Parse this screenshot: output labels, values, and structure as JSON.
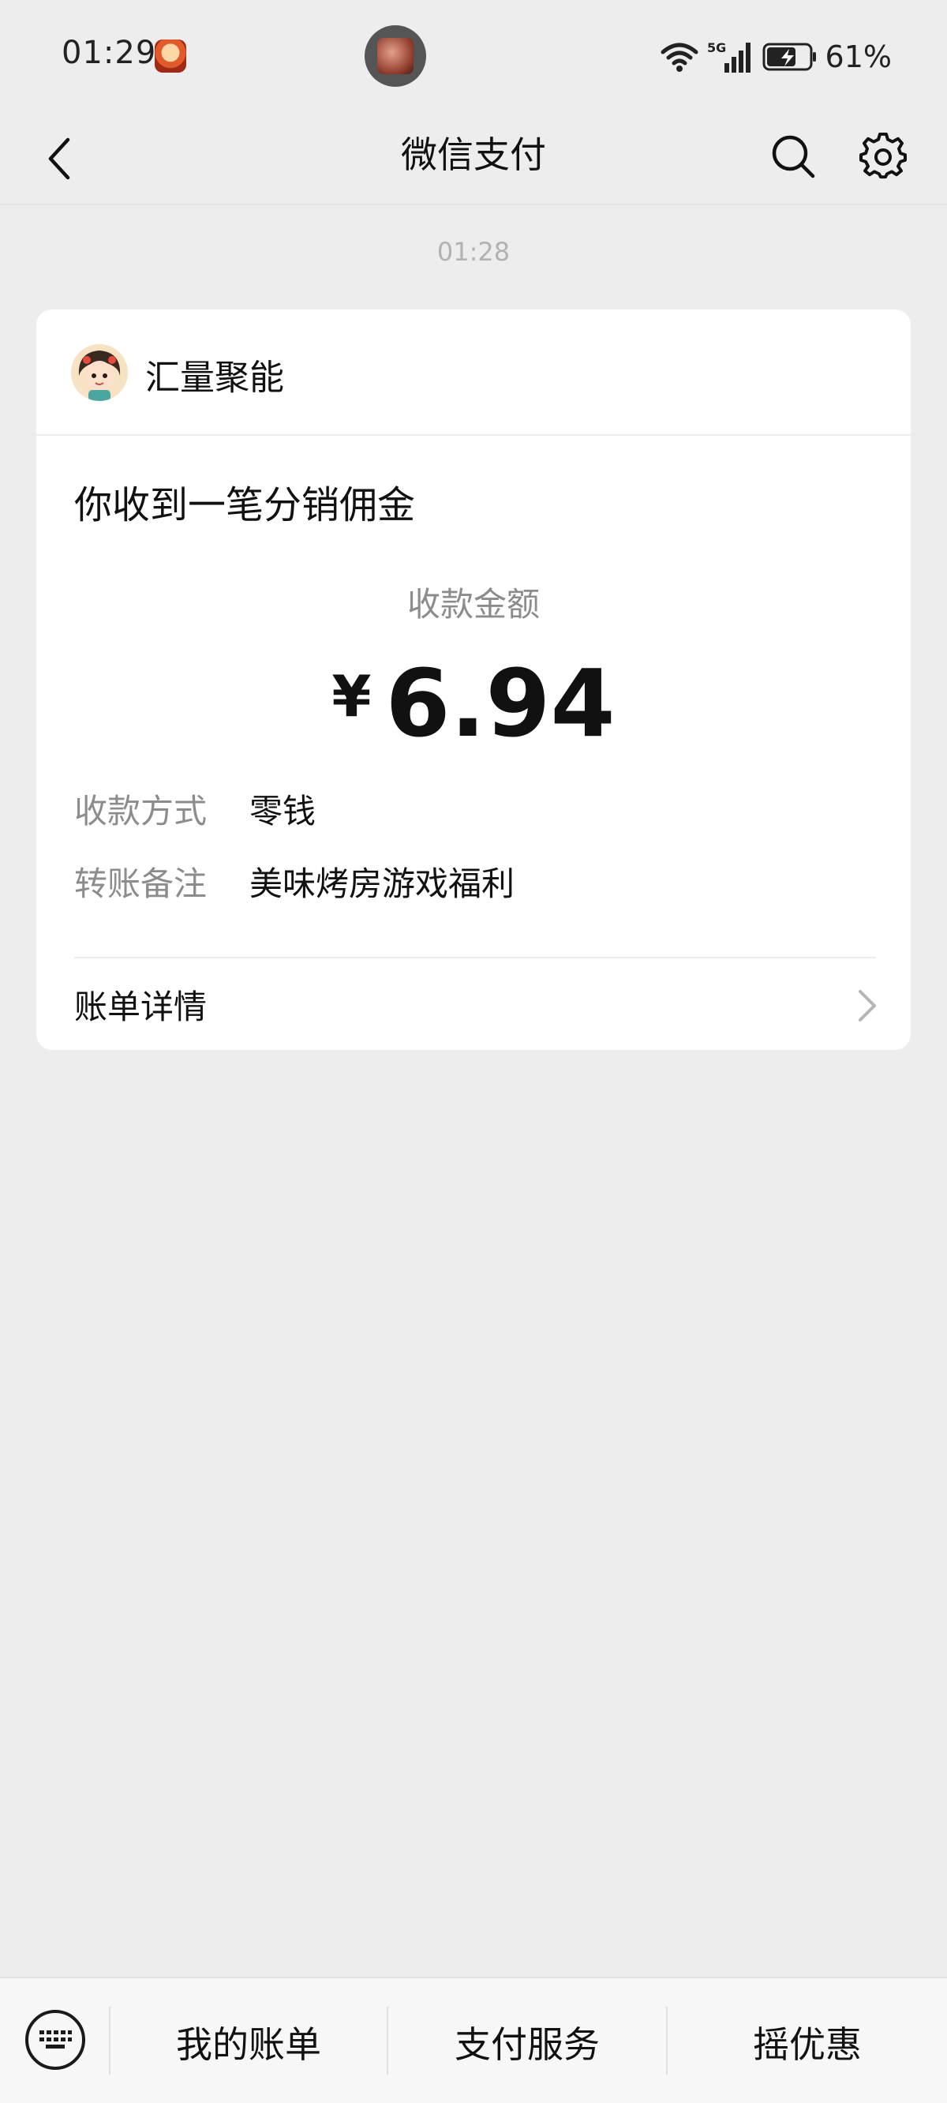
{
  "status_bar": {
    "time": "01:29",
    "network": "5G",
    "battery": "61%",
    "icons": [
      "app-notification-icon",
      "wifi-icon",
      "cellular-signal-icon",
      "battery-charging-icon"
    ]
  },
  "nav": {
    "title": "微信支付",
    "icons": [
      "back-arrow-icon",
      "search-icon",
      "gear-icon"
    ]
  },
  "message": {
    "time": "01:28"
  },
  "card": {
    "merchant_name": "汇量聚能",
    "title": "你收到一笔分销佣金",
    "amount_label": "收款金额",
    "currency": "¥",
    "amount": "6.94",
    "details": [
      {
        "label": "收款方式",
        "value": "零钱"
      },
      {
        "label": "转账备注",
        "value": "美味烤房游戏福利"
      }
    ],
    "bill_link": "账单详情"
  },
  "bottom_bar": {
    "keyboard_icon": "keyboard-icon",
    "items": [
      "我的账单",
      "支付服务",
      "摇优惠"
    ]
  },
  "colors": {
    "background": "#ededed",
    "card": "#ffffff",
    "muted_text": "#8c8c8c"
  }
}
